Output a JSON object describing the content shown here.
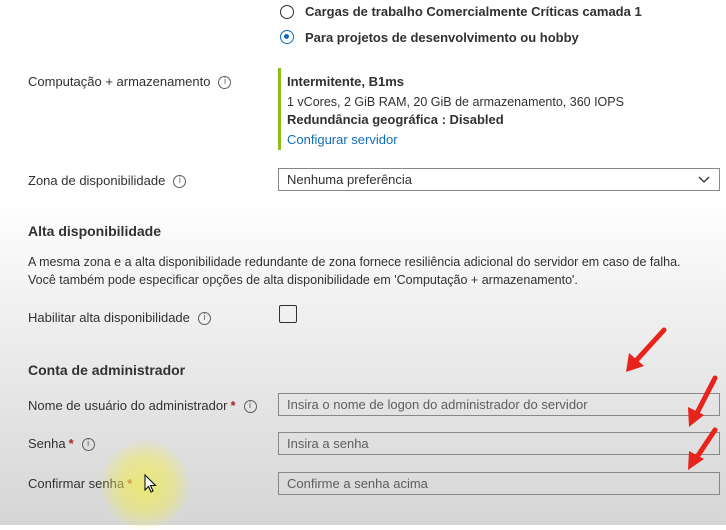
{
  "compute_tier": {
    "options": [
      {
        "label": "Cargas de trabalho Comercialmente Críticas camada 1",
        "selected": false
      },
      {
        "label": "Para projetos de desenvolvimento ou hobby",
        "selected": true
      }
    ]
  },
  "compute": {
    "label": "Computação + armazenamento",
    "tier_title": "Intermitente, B1ms",
    "spec": "1 vCores, 2 GiB RAM, 20 GiB de armazenamento, 360 IOPS",
    "geo_redundancy": "Redundância geográfica : Disabled",
    "configure_link": "Configurar servidor",
    "accent_color": "#8cbd18"
  },
  "availability_zone": {
    "label": "Zona de disponibilidade",
    "value": "Nenhuma preferência"
  },
  "high_availability": {
    "title": "Alta disponibilidade",
    "description_line1": "A mesma zona e a alta disponibilidade redundante de zona fornece resiliência adicional do servidor em caso de falha.",
    "description_line2": "Você também pode especificar opções de alta disponibilidade em 'Computação + armazenamento'.",
    "enable_label": "Habilitar alta disponibilidade",
    "enabled": false
  },
  "admin_account": {
    "title": "Conta de administrador",
    "username_label": "Nome de usuário do administrador",
    "username_placeholder": "Insira o nome de logon do administrador do servidor",
    "password_label": "Senha",
    "password_placeholder": "Insira a senha",
    "confirm_label": "Confirmar senha",
    "confirm_placeholder": "Confirme a senha acima",
    "required_marker": "*"
  },
  "icons": {
    "info": "info-icon",
    "chevron": "chevron-down-icon",
    "annotation": "red-arrow-icon",
    "cursor": "mouse-cursor-icon"
  },
  "colors": {
    "accent": "#0f6cbd",
    "required": "#a4262c",
    "annotation": "#e8231c"
  }
}
